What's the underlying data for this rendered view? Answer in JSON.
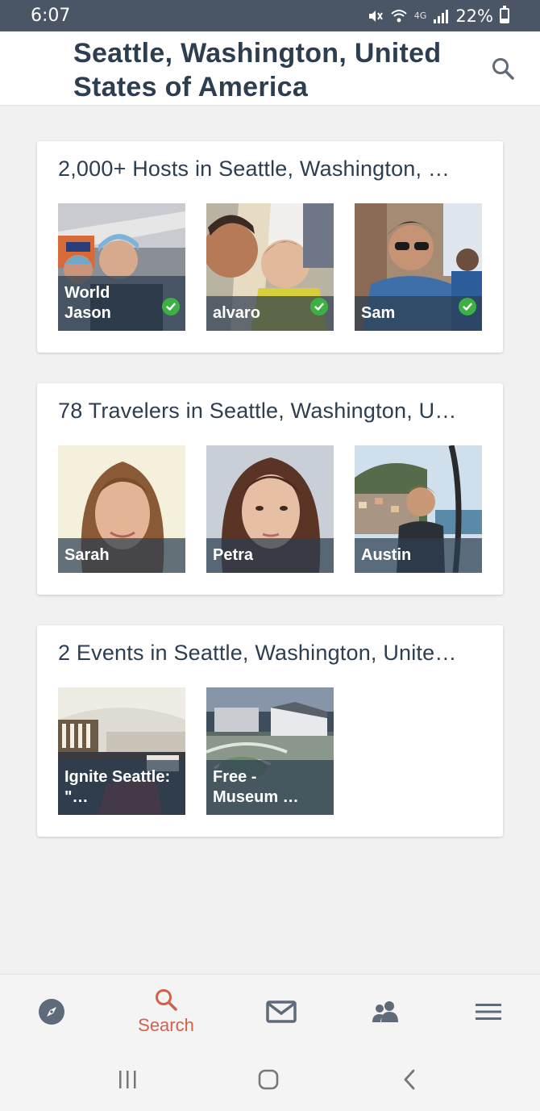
{
  "status_bar": {
    "time": "6:07",
    "network": "4G",
    "battery": "22%",
    "icons": [
      "mute-icon",
      "wifi-icon",
      "signal-icon",
      "battery-icon"
    ]
  },
  "header": {
    "title": "Seattle, Washington, United States of America",
    "search_icon": "search-icon"
  },
  "sections": [
    {
      "title": "2,000+ Hosts in Seattle, Washington, …",
      "tiles": [
        {
          "label": "World Jason",
          "verified": true
        },
        {
          "label": "alvaro",
          "verified": true
        },
        {
          "label": "Sam",
          "verified": true
        }
      ]
    },
    {
      "title": "78 Travelers in Seattle, Washington, U…",
      "tiles": [
        {
          "label": "Sarah"
        },
        {
          "label": "Petra"
        },
        {
          "label": "Austin"
        }
      ]
    },
    {
      "title": "2 Events in Seattle, Washington, Unite…",
      "tiles": [
        {
          "label": "Ignite Seattle: \"…"
        },
        {
          "label": "Free - Museum …"
        }
      ]
    }
  ],
  "bottom_nav": {
    "items": [
      {
        "icon": "compass-icon"
      },
      {
        "icon": "search-icon",
        "label": "Search",
        "active": true
      },
      {
        "icon": "mail-icon"
      },
      {
        "icon": "people-icon"
      },
      {
        "icon": "menu-icon"
      }
    ]
  },
  "colors": {
    "status_bar": "#4a5566",
    "accent": "#d2614a",
    "text": "#2c3e50",
    "verified": "#3cb043",
    "icon_gray": "#5f6b78"
  }
}
